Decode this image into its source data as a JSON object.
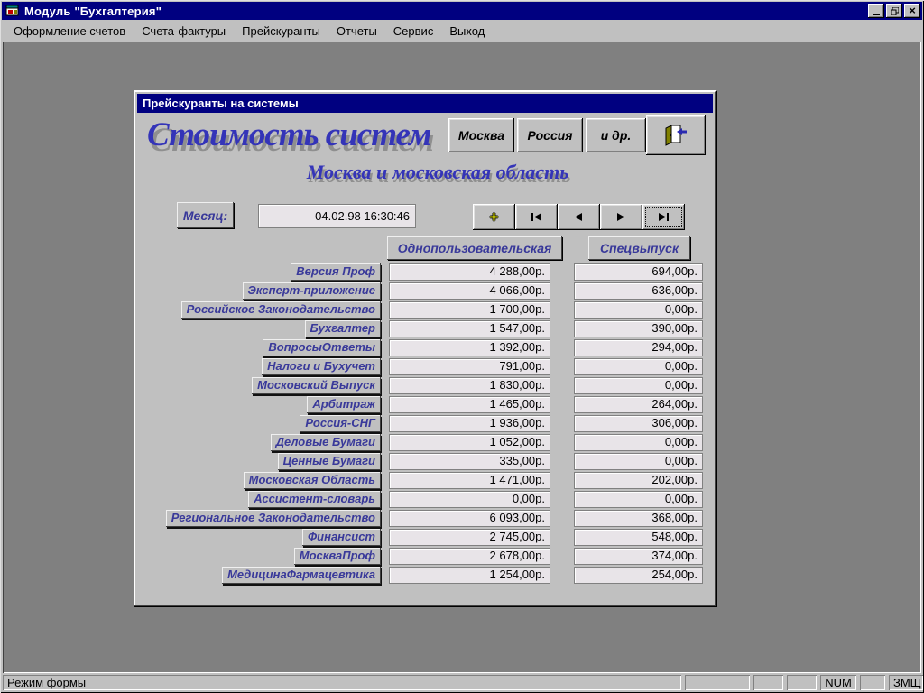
{
  "app": {
    "title": "Модуль \"Бухгалтерия\""
  },
  "menu": {
    "items": [
      "Оформление счетов",
      "Счета-фактуры",
      "Прейскуранты",
      "Отчеты",
      "Сервис",
      "Выход"
    ]
  },
  "form": {
    "title": "Прейскуранты на системы",
    "heading": "Стоимость систем",
    "subtitle": "Москва и московская область",
    "region_buttons": [
      "Москва",
      "Россия",
      "и др."
    ],
    "month": {
      "label": "Месяц:",
      "value": "04.02.98 16:30:46"
    },
    "columns": {
      "single": "Однопользовательская",
      "special": "Спецвыпуск"
    },
    "rows": [
      {
        "label": "Версия Проф",
        "single": "4 288,00р.",
        "special": "694,00р."
      },
      {
        "label": "Эксперт-приложение",
        "single": "4 066,00р.",
        "special": "636,00р."
      },
      {
        "label": "Российское Законодательство",
        "single": "1 700,00р.",
        "special": "0,00р."
      },
      {
        "label": "Бухгалтер",
        "single": "1 547,00р.",
        "special": "390,00р."
      },
      {
        "label": "ВопросыОтветы",
        "single": "1 392,00р.",
        "special": "294,00р."
      },
      {
        "label": "Налоги и Бухучет",
        "single": "791,00р.",
        "special": "0,00р."
      },
      {
        "label": "Московский Выпуск",
        "single": "1 830,00р.",
        "special": "0,00р."
      },
      {
        "label": "Арбитраж",
        "single": "1 465,00р.",
        "special": "264,00р."
      },
      {
        "label": "Россия-СНГ",
        "single": "1 936,00р.",
        "special": "306,00р."
      },
      {
        "label": "Деловые Бумаги",
        "single": "1 052,00р.",
        "special": "0,00р."
      },
      {
        "label": "Ценные Бумаги",
        "single": "335,00р.",
        "special": "0,00р."
      },
      {
        "label": "Московская Область",
        "single": "1 471,00р.",
        "special": "202,00р."
      },
      {
        "label": "Ассистент-словарь",
        "single": "0,00р.",
        "special": "0,00р."
      },
      {
        "label": "Региональное Законодательство",
        "single": "6 093,00р.",
        "special": "368,00р."
      },
      {
        "label": "Финансист",
        "single": "2 745,00р.",
        "special": "548,00р."
      },
      {
        "label": "МоскваПроф",
        "single": "2 678,00р.",
        "special": "374,00р."
      },
      {
        "label": "МедицинаФармацевтика",
        "single": "1 254,00р.",
        "special": "254,00р."
      }
    ]
  },
  "status": {
    "mode": "Режим формы",
    "num": "NUM",
    "scroll": "ЗМЩ"
  },
  "colors": {
    "title_navy": "#000080",
    "accent_blue": "#39399a",
    "heading_blue": "#3434b8",
    "desktop_gray": "#808080",
    "chrome_gray": "#c0c0c0",
    "field_bg": "#e8e4e8"
  }
}
